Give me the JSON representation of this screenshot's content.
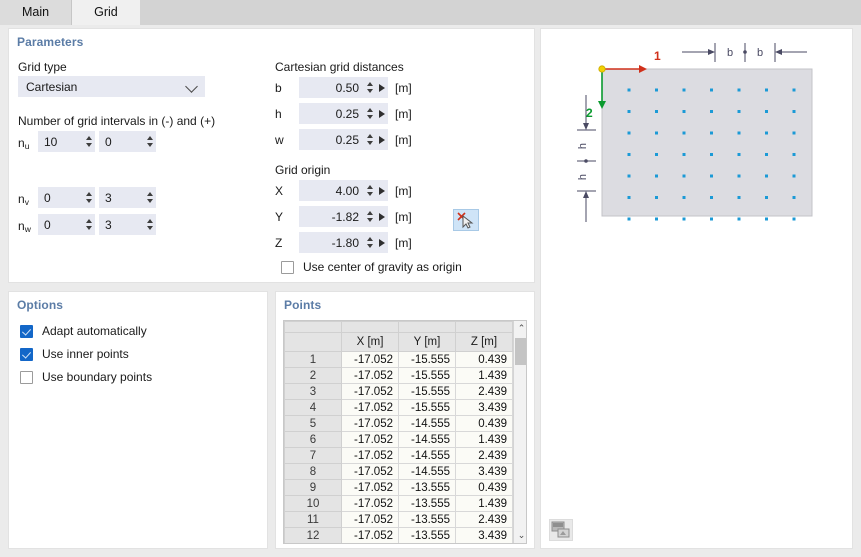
{
  "tabs": [
    {
      "label": "Main",
      "active": false
    },
    {
      "label": "Grid",
      "active": true
    }
  ],
  "parameters": {
    "legend": "Parameters",
    "grid_type_label": "Grid type",
    "grid_type_value": "Cartesian",
    "grid_type_options": [
      "Cartesian"
    ],
    "intervals_label": "Number of grid intervals in (-) and (+)",
    "intervals": [
      {
        "name": "n",
        "sub": "u",
        "minus": "10",
        "plus": "0"
      },
      {
        "name": "n",
        "sub": "v",
        "minus": "0",
        "plus": "3"
      },
      {
        "name": "n",
        "sub": "w",
        "minus": "0",
        "plus": "3"
      }
    ],
    "distances_label": "Cartesian grid distances",
    "distances": [
      {
        "name": "b",
        "value": "0.50",
        "unit": "[m]"
      },
      {
        "name": "h",
        "value": "0.25",
        "unit": "[m]"
      },
      {
        "name": "w",
        "value": "0.25",
        "unit": "[m]"
      }
    ],
    "origin_label": "Grid origin",
    "origin": [
      {
        "name": "X",
        "value": "4.00",
        "unit": "[m]"
      },
      {
        "name": "Y",
        "value": "-1.82",
        "unit": "[m]"
      },
      {
        "name": "Z",
        "value": "-1.80",
        "unit": "[m]"
      }
    ],
    "pick_button_icon": "pick-point-icon",
    "cog_checkbox": {
      "label": "Use center of gravity as origin",
      "checked": false
    }
  },
  "options": {
    "legend": "Options",
    "items": [
      {
        "label": "Adapt automatically",
        "checked": true
      },
      {
        "label": "Use inner points",
        "checked": true
      },
      {
        "label": "Use boundary points",
        "checked": false
      }
    ]
  },
  "points": {
    "legend": "Points",
    "columns": [
      "X [m]",
      "Y [m]",
      "Z [m]"
    ],
    "rows": [
      {
        "n": "1",
        "x": "-17.052",
        "y": "-15.555",
        "z": "0.439"
      },
      {
        "n": "2",
        "x": "-17.052",
        "y": "-15.555",
        "z": "1.439"
      },
      {
        "n": "3",
        "x": "-17.052",
        "y": "-15.555",
        "z": "2.439"
      },
      {
        "n": "4",
        "x": "-17.052",
        "y": "-15.555",
        "z": "3.439"
      },
      {
        "n": "5",
        "x": "-17.052",
        "y": "-14.555",
        "z": "0.439"
      },
      {
        "n": "6",
        "x": "-17.052",
        "y": "-14.555",
        "z": "1.439"
      },
      {
        "n": "7",
        "x": "-17.052",
        "y": "-14.555",
        "z": "2.439"
      },
      {
        "n": "8",
        "x": "-17.052",
        "y": "-14.555",
        "z": "3.439"
      },
      {
        "n": "9",
        "x": "-17.052",
        "y": "-13.555",
        "z": "0.439"
      },
      {
        "n": "10",
        "x": "-17.052",
        "y": "-13.555",
        "z": "1.439"
      },
      {
        "n": "11",
        "x": "-17.052",
        "y": "-13.555",
        "z": "2.439"
      },
      {
        "n": "12",
        "x": "-17.052",
        "y": "-13.555",
        "z": "3.439"
      }
    ],
    "scroll_up_glyph": "⌃",
    "scroll_down_glyph": "⌄"
  },
  "preview": {
    "axis_1_label": "1",
    "axis_2_label": "2",
    "h_dim_labels": [
      "b",
      "b"
    ],
    "v_dim_labels": [
      "h",
      "h"
    ],
    "dot_rows": 7,
    "dot_cols": 7,
    "render_button_icon": "image-render-icon"
  },
  "colors": {
    "legend_text": "#5b7ca6",
    "field_bg": "#e7e9f2",
    "checkbox_on": "#1367c8",
    "axis_1": "#d0301a",
    "axis_2": "#0a9a2e",
    "origin_dot": "#f2d000",
    "grid_dot": "#1b9ad6",
    "preview_plate": "#dcdce1"
  }
}
